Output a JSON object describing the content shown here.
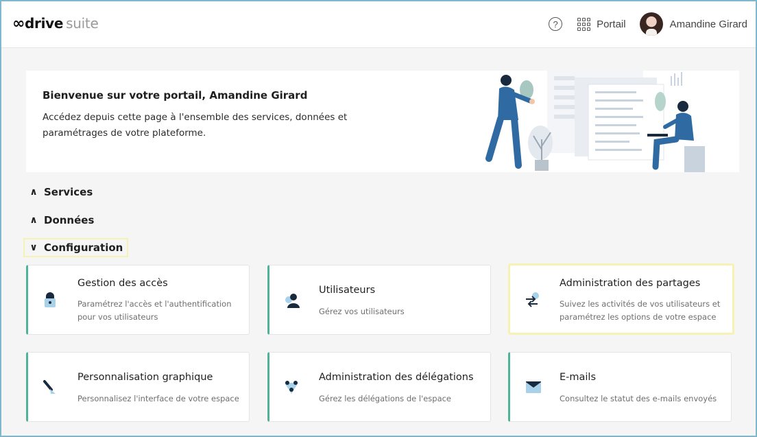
{
  "header": {
    "logo_infinity": "∞",
    "logo_brand": "drive",
    "logo_suite": "suite",
    "help_symbol": "?",
    "portal_label": "Portail",
    "user_name": "Amandine Girard"
  },
  "welcome": {
    "title": "Bienvenue sur votre portail, Amandine Girard",
    "description": "Accédez depuis cette page à l'ensemble des services, données et paramétrages de votre plateforme."
  },
  "sections": [
    {
      "label": "Services",
      "chevron": "∧",
      "expanded": false
    },
    {
      "label": "Données",
      "chevron": "∧",
      "expanded": false
    },
    {
      "label": "Configuration",
      "chevron": "∨",
      "expanded": true
    }
  ],
  "cards": [
    {
      "title": "Gestion des accès",
      "description": "Paramétrez l'accès et l'authentification pour vos utilisateurs",
      "icon": "lock-icon"
    },
    {
      "title": "Utilisateurs",
      "description": "Gérez vos utilisateurs",
      "icon": "user-icon"
    },
    {
      "title": "Administration des partages",
      "description": "Suivez les activités de vos utilisateurs et paramétrez les options de votre espace",
      "icon": "share-settings-icon"
    },
    {
      "title": "Personnalisation graphique",
      "description": "Personnalisez l'interface de votre espace",
      "icon": "brush-icon"
    },
    {
      "title": "Administration des délégations",
      "description": "Gérez les délégations de l'espace",
      "icon": "delegation-icon"
    },
    {
      "title": "E-mails",
      "description": "Consultez le statut des e-mails envoyés",
      "icon": "envelope-icon"
    }
  ],
  "colors": {
    "accent": "#4fb39a",
    "focus_highlight": "#f6f2b4",
    "icon_dark": "#1a2a3e",
    "icon_light": "#a8d2ea",
    "illustration_blue": "#2f6aa3"
  }
}
